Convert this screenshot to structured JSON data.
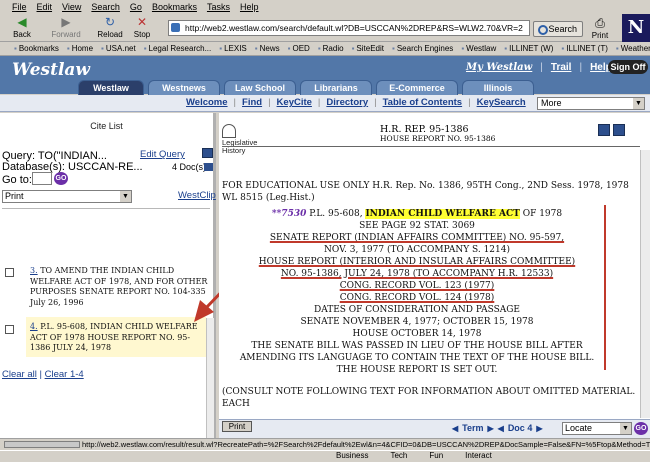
{
  "browser": {
    "menu": [
      "File",
      "Edit",
      "View",
      "Search",
      "Go",
      "Bookmarks",
      "Tasks",
      "Help"
    ],
    "toolbar": {
      "back": "Back",
      "forward": "Forward",
      "reload": "Reload",
      "stop": "Stop",
      "search": "Search",
      "print": "Print"
    },
    "address": "http://web2.westlaw.com/search/default.wl?DB=USCCAN%2DREP&RS=WLW2.70&VR=2",
    "bookmarks": [
      "Bookmarks",
      "Home",
      "USA.net",
      "Legal Research...",
      "LEXIS",
      "News",
      "OED",
      "Radio",
      "SiteEdit",
      "Search Engines",
      "Westlaw",
      "ILLINET (W)",
      "ILLINET (T)",
      "Weather"
    ],
    "status_url": "http://web2.westlaw.com/result/result.wl?RecreatePath=%2FSearch%2Fdefault%2Ewl&n=4&CFID=0&DB=USCCAN%2DREP&DocSample=False&FN=%5Ftop&Method=TNC&MT=W...",
    "taskbar": [
      "Business",
      "Tech",
      "Fun",
      "Interact"
    ]
  },
  "westlaw": {
    "logo": "Westlaw",
    "links": {
      "mywestlaw": "My Westlaw",
      "trail": "Trail",
      "help": "Help",
      "signoff": "Sign Off"
    },
    "tabs": [
      "Westlaw",
      "Westnews",
      "Law School",
      "Librarians",
      "E-Commerce",
      "Illinois"
    ],
    "subnav": [
      "Welcome",
      "Find",
      "KeyCite",
      "Directory",
      "Table of Contents",
      "KeySearch"
    ],
    "more": "More"
  },
  "left": {
    "heading": "Cite List",
    "query_label": "Query: TO(\"INDIAN...",
    "database_label": "Database(s): USCCAN-RE...",
    "edit_query": "Edit Query",
    "docs_count": "4 Doc(s)",
    "goto_label": "Go to:",
    "go": "GO",
    "print_option": "Print",
    "westclip": "WestClip",
    "results": [
      {
        "num": "3.",
        "text": "TO AMEND THE INDIAN CHILD WELFARE ACT OF 1978, AND FOR OTHER PURPOSES SENATE REPORT NO. 104-335 July 26, 1996"
      },
      {
        "num": "4.",
        "text": "P.L. 95-608, INDIAN CHILD WELFARE ACT OF 1978 HOUSE REPORT NO. 95-1386 JULY 24, 1978"
      }
    ],
    "clear_all": "Clear all",
    "clear_range": "Clear 1-4"
  },
  "doc": {
    "leg_hist": "Legislative History",
    "title": "H.R. REP. 95-1386",
    "subtitle": "HOUSE REPORT NO. 95-1386",
    "edu_line": "FOR EDUCATIONAL USE ONLY H.R. Rep. No. 1386, 95TH Cong., 2ND Sess. 1978, 1978 WL 8515 (Leg.Hist.)",
    "star_page": "**7530",
    "pl_prefix": "P.L. 95-608,",
    "act_name": "INDIAN CHILD WELFARE ACT",
    "act_year": "OF 1978",
    "see_page": "SEE PAGE 92 STAT. 3069",
    "senate_report": "SENATE REPORT (INDIAN AFFAIRS COMMITTEE) NO. 95-597,",
    "senate_date": "NOV. 3, 1977 (TO ACCOMPANY S. 1214)",
    "house_report": "HOUSE REPORT (INTERIOR AND INSULAR AFFAIRS COMMITTEE)",
    "house_no": "NO. 95-1386, JULY 24, 1978 (TO ACCOMPANY H.R. 12533)",
    "cong_rec_1": "CONG. RECORD VOL. 123 (1977)",
    "cong_rec_2": "CONG. RECORD VOL. 124 (1978)",
    "dates_head": "DATES OF CONSIDERATION AND PASSAGE",
    "senate_dates": "SENATE NOVEMBER 4, 1977; OCTOBER 15, 1978",
    "house_dates": "HOUSE OCTOBER 14, 1978",
    "passed_text": "THE SENATE BILL WAS PASSED IN LIEU OF THE HOUSE BILL AFTER AMENDING ITS LANGUAGE TO CONTAIN THE TEXT OF THE HOUSE BILL.",
    "report_set": "THE HOUSE REPORT IS SET OUT.",
    "consult": "(CONSULT NOTE FOLLOWING TEXT FOR INFORMATION ABOUT OMITTED MATERIAL. EACH"
  },
  "bottom": {
    "print": "Print",
    "term": "Term",
    "doc": "Doc 4",
    "locate": "Locate",
    "go": "GO"
  }
}
